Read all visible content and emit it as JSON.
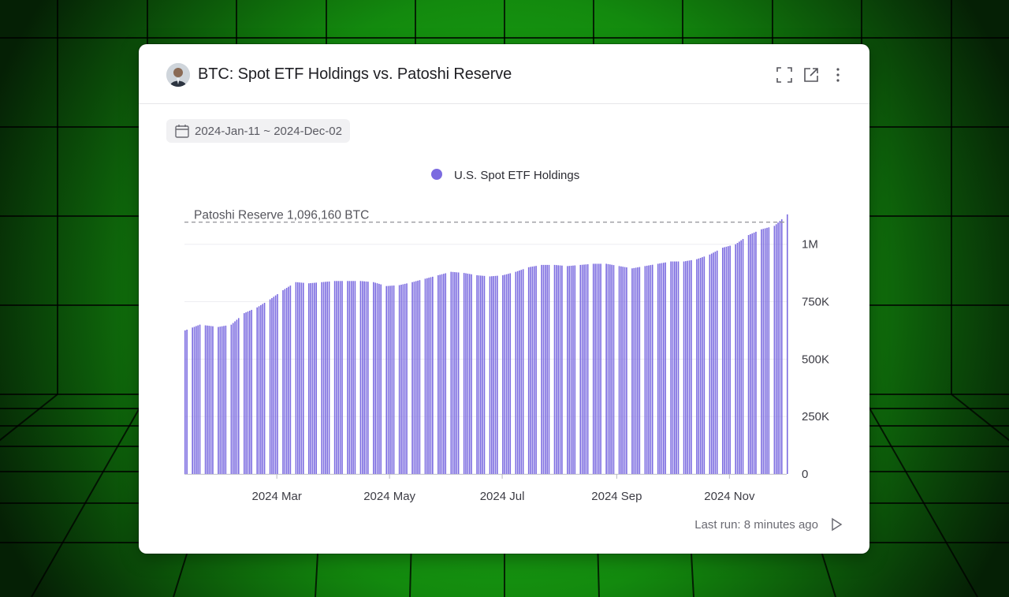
{
  "header": {
    "title": "BTC: Spot ETF Holdings vs. Patoshi Reserve",
    "avatar_icon": "user-avatar",
    "actions": [
      "fullscreen-icon",
      "open-external-icon",
      "more-vertical-icon"
    ]
  },
  "filter": {
    "date_range": "2024-Jan-11 ~ 2024-Dec-02",
    "icon": "calendar-icon"
  },
  "footer": {
    "last_run": "Last run: 8 minutes ago",
    "icon": "play-icon"
  },
  "colors": {
    "bar": "#7b6be0",
    "reference_line": "#9a9aa0",
    "background_glow": "#22c01a"
  },
  "chart_data": {
    "type": "bar",
    "legend": [
      "U.S. Spot ETF Holdings"
    ],
    "legend_position": "top-center",
    "x_ticks": [
      "2024 Mar",
      "2024 May",
      "2024 Jul",
      "2024 Sep",
      "2024 Nov"
    ],
    "x_range": [
      "2024-01-11",
      "2024-12-02"
    ],
    "y_axis_side": "right",
    "y_ticks": [
      0,
      250000,
      500000,
      750000,
      1000000
    ],
    "y_tick_labels": [
      "0",
      "250K",
      "500K",
      "750K",
      "1M"
    ],
    "ylim": [
      0,
      1150000
    ],
    "grid": true,
    "reference_line": {
      "label": "Patoshi Reserve 1,096,160 BTC",
      "value": 1096160,
      "style": "dashed"
    },
    "series": [
      {
        "name": "U.S. Spot ETF Holdings",
        "points": [
          [
            "2024-01-11",
            625000
          ],
          [
            "2024-01-19",
            650000
          ],
          [
            "2024-01-29",
            640000
          ],
          [
            "2024-02-05",
            650000
          ],
          [
            "2024-02-12",
            700000
          ],
          [
            "2024-02-19",
            725000
          ],
          [
            "2024-02-26",
            760000
          ],
          [
            "2024-03-04",
            800000
          ],
          [
            "2024-03-11",
            835000
          ],
          [
            "2024-03-18",
            830000
          ],
          [
            "2024-03-25",
            835000
          ],
          [
            "2024-04-01",
            840000
          ],
          [
            "2024-04-08",
            840000
          ],
          [
            "2024-04-15",
            840000
          ],
          [
            "2024-04-22",
            835000
          ],
          [
            "2024-04-29",
            818000
          ],
          [
            "2024-05-06",
            822000
          ],
          [
            "2024-05-13",
            835000
          ],
          [
            "2024-05-20",
            850000
          ],
          [
            "2024-05-27",
            865000
          ],
          [
            "2024-06-03",
            880000
          ],
          [
            "2024-06-10",
            875000
          ],
          [
            "2024-06-17",
            865000
          ],
          [
            "2024-06-24",
            860000
          ],
          [
            "2024-07-01",
            865000
          ],
          [
            "2024-07-08",
            880000
          ],
          [
            "2024-07-15",
            900000
          ],
          [
            "2024-07-22",
            910000
          ],
          [
            "2024-07-29",
            910000
          ],
          [
            "2024-08-05",
            905000
          ],
          [
            "2024-08-12",
            910000
          ],
          [
            "2024-08-19",
            915000
          ],
          [
            "2024-08-26",
            915000
          ],
          [
            "2024-09-02",
            905000
          ],
          [
            "2024-09-09",
            895000
          ],
          [
            "2024-09-16",
            905000
          ],
          [
            "2024-09-23",
            915000
          ],
          [
            "2024-09-30",
            925000
          ],
          [
            "2024-10-07",
            925000
          ],
          [
            "2024-10-14",
            935000
          ],
          [
            "2024-10-21",
            955000
          ],
          [
            "2024-10-28",
            985000
          ],
          [
            "2024-11-04",
            1000000
          ],
          [
            "2024-11-11",
            1040000
          ],
          [
            "2024-11-18",
            1065000
          ],
          [
            "2024-11-25",
            1080000
          ],
          [
            "2024-12-02",
            1130000
          ]
        ]
      }
    ]
  }
}
